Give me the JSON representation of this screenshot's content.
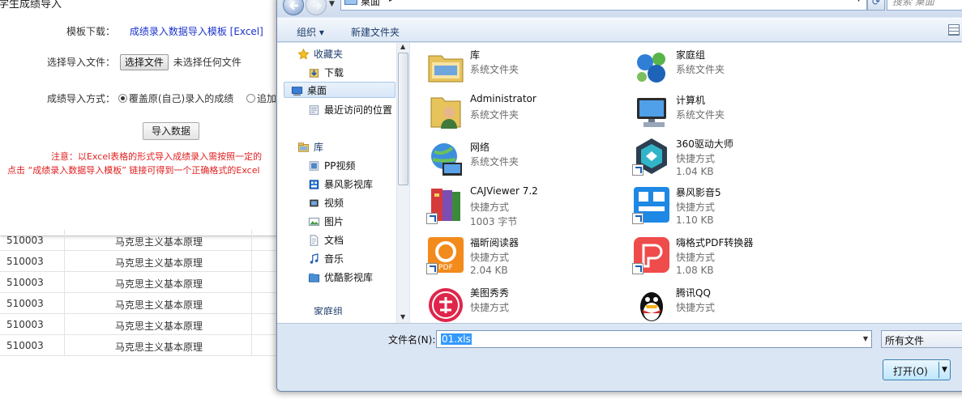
{
  "background_page": {
    "modal_title": "学生成绩导入",
    "template_label": "模板下载：",
    "template_link": "成绩录入数据导入模板 [Excel]",
    "file_label": "选择导入文件：",
    "choose_file_button": "选择文件",
    "no_file_text": "未选择任何文件",
    "mode_label": "成绩导入方式：",
    "mode_overwrite": "覆盖原(自己)录入的成绩",
    "mode_append": "追加导",
    "import_button": "导入数据",
    "note_line1": "注意：以Excel表格的形式导入成绩录入需按照一定的",
    "note_line2": "点击 “成绩录入数据导入模板” 链接可得到一个正确格式的Excel",
    "table_rows": [
      {
        "code": "510003",
        "course": "马克思主义基本原理"
      },
      {
        "code": "510003",
        "course": "马克思主义基本原理"
      },
      {
        "code": "510003",
        "course": "马克思主义基本原理"
      },
      {
        "code": "510003",
        "course": "马克思主义基本原理"
      },
      {
        "code": "510003",
        "course": "马克思主义基本原理"
      },
      {
        "code": "510003",
        "course": "马克思主义基本原理"
      }
    ]
  },
  "dialog": {
    "address": "桌面",
    "search_placeholder": "搜索 桌面",
    "toolbar": {
      "organize": "组织 ▾",
      "new_folder": "新建文件夹"
    },
    "nav": {
      "favorites": "收藏夹",
      "downloads": "下载",
      "desktop": "桌面",
      "recent": "最近访问的位置",
      "libraries": "库",
      "pp_video": "PP视频",
      "baofeng_lib": "暴风影视库",
      "videos": "视频",
      "pictures": "图片",
      "documents": "文档",
      "music": "音乐",
      "youku_lib": "优酷影视库",
      "homegroup": "家庭组"
    },
    "files": [
      {
        "name": "库",
        "type": "系统文件夹",
        "size": "",
        "icon": "library-icon"
      },
      {
        "name": "家庭组",
        "type": "系统文件夹",
        "size": "",
        "icon": "homegroup-icon"
      },
      {
        "name": "Administrator",
        "type": "系统文件夹",
        "size": "",
        "icon": "user-folder-icon"
      },
      {
        "name": "计算机",
        "type": "系统文件夹",
        "size": "",
        "icon": "computer-icon"
      },
      {
        "name": "网络",
        "type": "系统文件夹",
        "size": "",
        "icon": "network-icon"
      },
      {
        "name": "360驱动大师",
        "type": "快捷方式",
        "size": "1.04 KB",
        "icon": "driver-master-icon"
      },
      {
        "name": "CAJViewer 7.2",
        "type": "快捷方式",
        "size": "1003 字节",
        "icon": "cajviewer-icon"
      },
      {
        "name": "暴风影音5",
        "type": "快捷方式",
        "size": "1.10 KB",
        "icon": "baofeng-icon"
      },
      {
        "name": "福昕阅读器",
        "type": "快捷方式",
        "size": "2.04 KB",
        "icon": "foxit-icon"
      },
      {
        "name": "嗨格式PDF转换器",
        "type": "快捷方式",
        "size": "1.08 KB",
        "icon": "pdf-converter-icon"
      },
      {
        "name": "美图秀秀",
        "type": "快捷方式",
        "size": "",
        "icon": "meitu-icon"
      },
      {
        "name": "腾讯QQ",
        "type": "快捷方式",
        "size": "",
        "icon": "qq-icon"
      }
    ],
    "filename_label": "文件名(N):",
    "filename_value": "01.xls",
    "filter_value": "所有文件",
    "open_button": "打开(O)"
  }
}
